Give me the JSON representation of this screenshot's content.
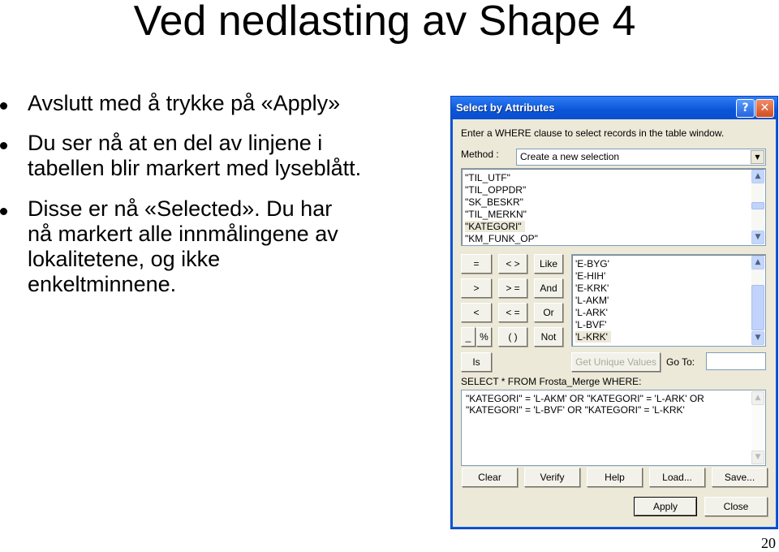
{
  "slide": {
    "title": "Ved nedlasting av Shape 4",
    "bullets": [
      [
        "Avslutt med å trykke på «Apply»"
      ],
      [
        "Du ser nå at en del av linjene i",
        "tabellen blir markert med lyseblått."
      ],
      [
        "Disse er nå «Selected». Du har",
        "nå markert alle innmålingene av",
        "lokalitetene, og ikke",
        "enkeltminnene."
      ]
    ],
    "page_number": "20"
  },
  "dialog": {
    "title": "Select by Attributes",
    "help_icon": "?",
    "close_icon": "✕",
    "instruction": "Enter a WHERE clause to select records in the table window.",
    "method_label": "Method :",
    "method_value": "Create a new selection",
    "fields": [
      "\"TIL_UTF\"",
      "\"TIL_OPPDR\"",
      "\"SK_BESKR\"",
      "\"TIL_MERKN\"",
      "\"KATEGORI\"",
      "\"KM_FUNK_OP\""
    ],
    "selected_field": "\"KATEGORI\"",
    "operators": [
      "=",
      "< >",
      "Like",
      ">",
      "> =",
      "And",
      "<",
      "< =",
      "Or",
      "_",
      "%",
      "( )",
      "Not",
      "Is"
    ],
    "values": [
      "'E-BYG'",
      "'E-HIH'",
      "'E-KRK'",
      "'L-AKM'",
      "'L-ARK'",
      "'L-BVF'",
      "'L-KRK'"
    ],
    "selected_value": "'L-KRK'",
    "get_unique_values_label": "Get Unique Values",
    "goto_label": "Go To:",
    "goto_value": "",
    "sql_prefix": "SELECT * FROM Frosta_Merge WHERE:",
    "sql_lines": [
      "\"KATEGORI\" = 'L-AKM' OR \"KATEGORI\" = 'L-ARK' OR",
      "\"KATEGORI\" = 'L-BVF' OR \"KATEGORI\" = 'L-KRK'"
    ],
    "buttons": {
      "clear": "Clear",
      "verify": "Verify",
      "help": "Help",
      "load": "Load...",
      "save": "Save...",
      "apply": "Apply",
      "close": "Close"
    },
    "scroll_up": "▲",
    "scroll_down": "▼",
    "combo_arrow": "▼"
  }
}
